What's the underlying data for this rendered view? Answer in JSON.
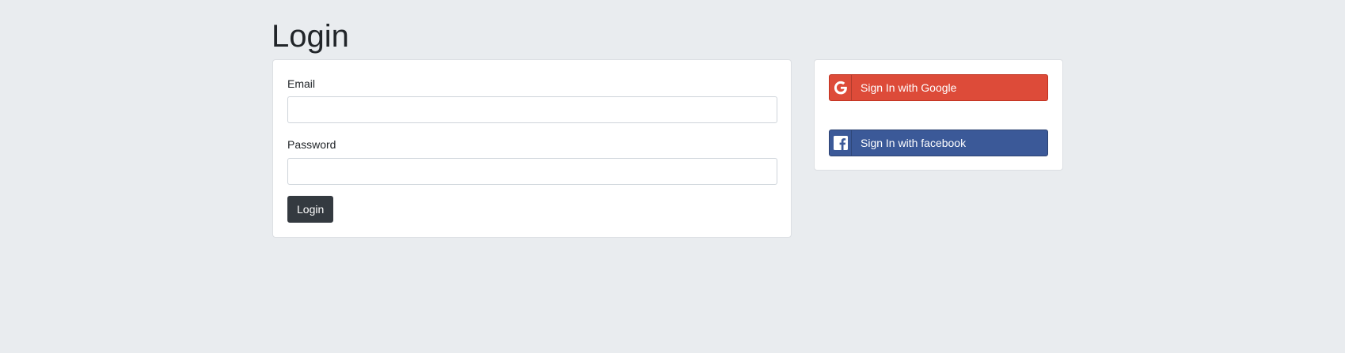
{
  "page": {
    "title": "Login"
  },
  "login_form": {
    "email_label": "Email",
    "email_value": "",
    "password_label": "Password",
    "password_value": "",
    "submit_label": "Login"
  },
  "social_login": {
    "google": {
      "label": "Sign In with Google",
      "icon": "google-icon",
      "color": "#dd4b39"
    },
    "facebook": {
      "label": "Sign In with facebook",
      "icon": "facebook-icon",
      "color": "#3b5998"
    }
  },
  "colors": {
    "background": "#e9ecef",
    "card": "#ffffff",
    "primary_button": "#343a40"
  }
}
